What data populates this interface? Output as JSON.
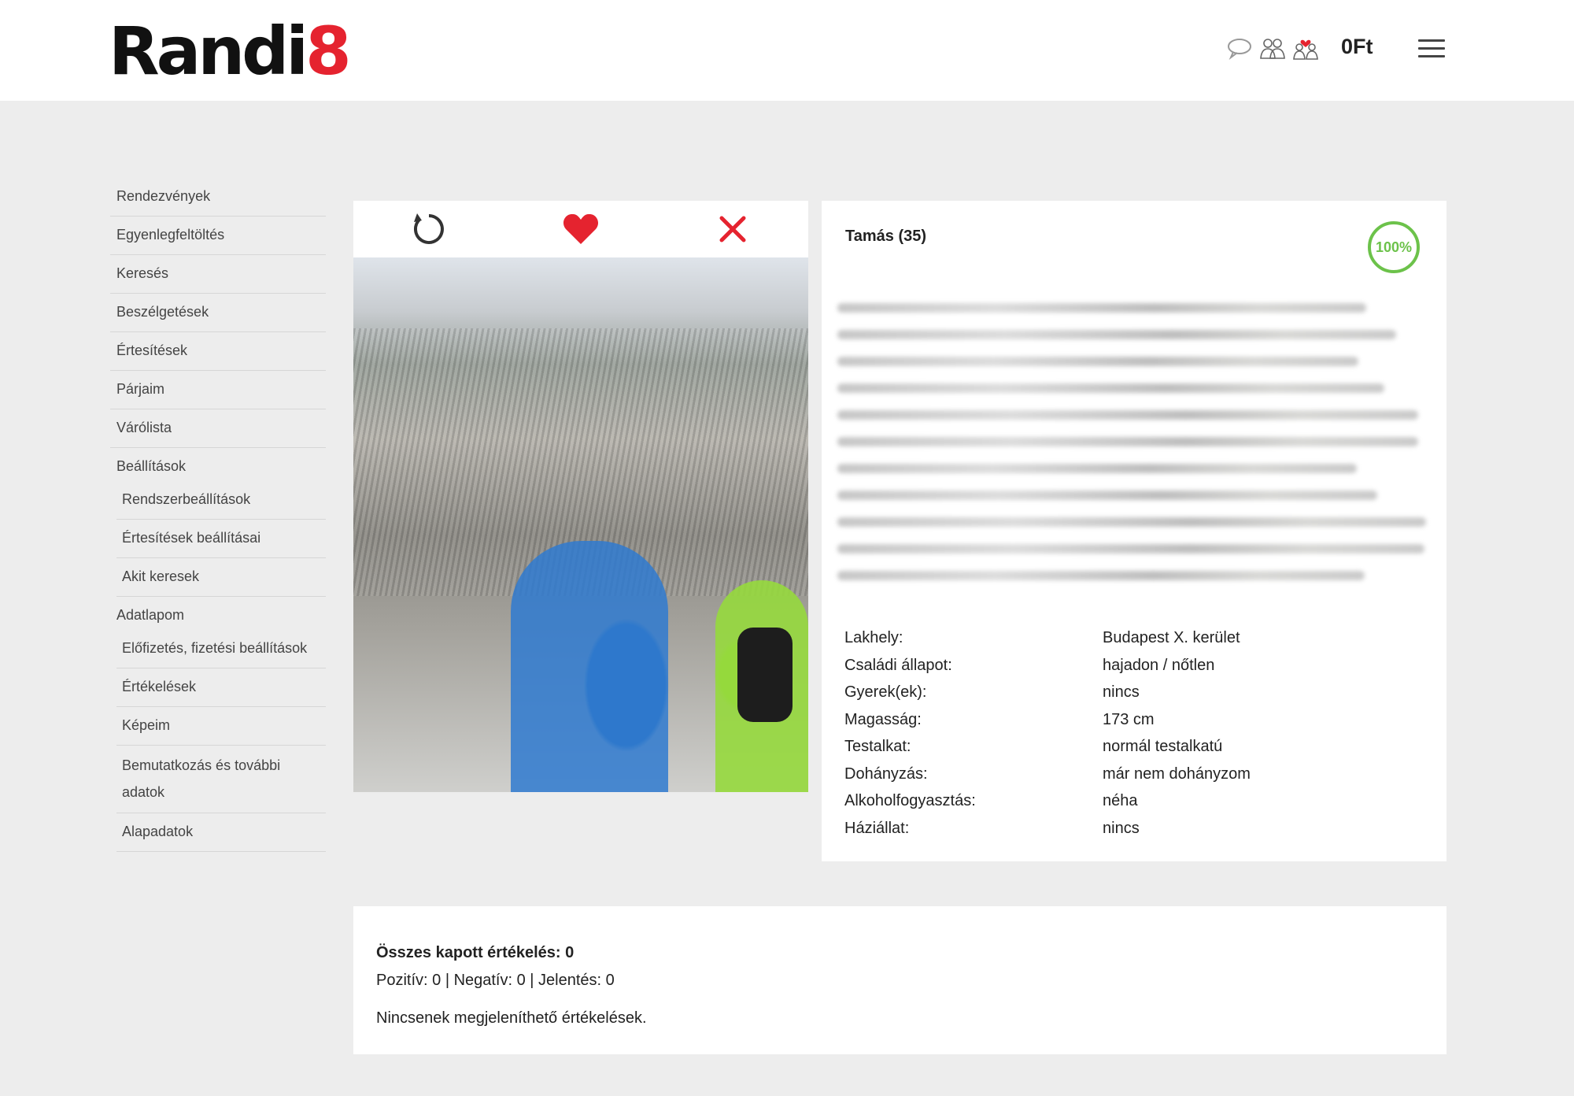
{
  "header": {
    "logo_text": "Randi",
    "logo_accent": "8",
    "icons": [
      "chat-icon",
      "people-icon",
      "couple-heart-icon"
    ],
    "balance": "0Ft",
    "menu_icon": "hamburger-icon"
  },
  "sidebar": {
    "items": [
      {
        "label": "Rendezvények"
      },
      {
        "label": "Egyenlegfeltöltés"
      },
      {
        "label": "Keresés"
      },
      {
        "label": "Beszélgetések"
      },
      {
        "label": "Értesítések"
      },
      {
        "label": "Párjaim"
      },
      {
        "label": "Várólista"
      },
      {
        "label": "Beállítások"
      },
      {
        "label": "Rendszerbeállítások"
      },
      {
        "label": "Értesítések beállításai"
      },
      {
        "label": "Akit keresek"
      },
      {
        "label": "Adatlapom"
      },
      {
        "label": "Előfizetés, fizetési beállítások"
      },
      {
        "label": "Értékelések"
      },
      {
        "label": "Képeim"
      },
      {
        "label": "Bemutatkozás és további adatok"
      },
      {
        "label": "Alapadatok"
      }
    ]
  },
  "photo_actions": {
    "icons": [
      "undo-icon",
      "heart-icon",
      "close-icon"
    ]
  },
  "profile": {
    "name": "Tamás (35)",
    "completeness": "100%",
    "details": [
      {
        "key": "Lakhely:",
        "value": "Budapest X. kerület"
      },
      {
        "key": "Családi állapot:",
        "value": "hajadon / nőtlen"
      },
      {
        "key": "Gyerek(ek):",
        "value": "nincs"
      },
      {
        "key": "Magasság:",
        "value": "173 cm"
      },
      {
        "key": "Testalkat:",
        "value": "normál testalkatú"
      },
      {
        "key": "Dohányzás:",
        "value": "már nem dohányzom"
      },
      {
        "key": "Alkoholfogyasztás:",
        "value": "néha"
      },
      {
        "key": "Háziállat:",
        "value": "nincs"
      }
    ]
  },
  "ratings": {
    "title": "Összes kapott értékelés: 0",
    "stats": "Pozitív: 0 | Negatív: 0 | Jelentés: 0",
    "empty": "Nincsenek megjeleníthető értékelések."
  },
  "colors": {
    "accent_red": "#e5232f",
    "percent_green": "#6cc24a",
    "page_bg": "#ededed"
  }
}
